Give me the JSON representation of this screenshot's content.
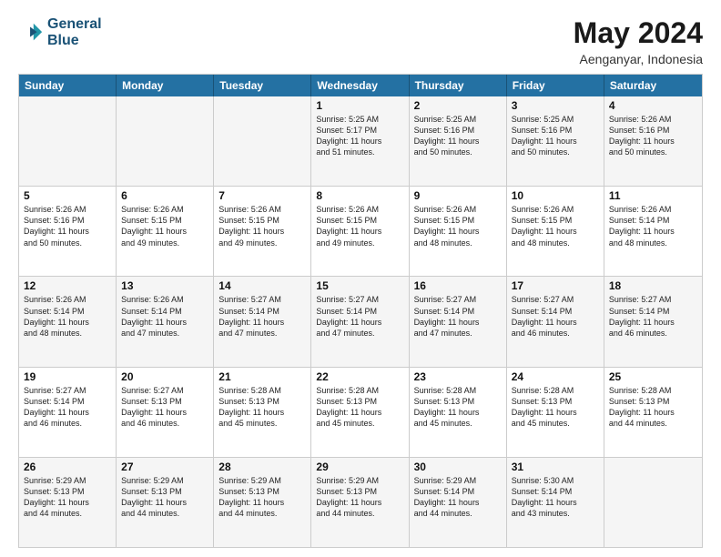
{
  "header": {
    "logo_line1": "General",
    "logo_line2": "Blue",
    "month_year": "May 2024",
    "location": "Aenganyar, Indonesia"
  },
  "weekdays": [
    "Sunday",
    "Monday",
    "Tuesday",
    "Wednesday",
    "Thursday",
    "Friday",
    "Saturday"
  ],
  "rows": [
    [
      {
        "day": "",
        "text": ""
      },
      {
        "day": "",
        "text": ""
      },
      {
        "day": "",
        "text": ""
      },
      {
        "day": "1",
        "text": "Sunrise: 5:25 AM\nSunset: 5:17 PM\nDaylight: 11 hours\nand 51 minutes."
      },
      {
        "day": "2",
        "text": "Sunrise: 5:25 AM\nSunset: 5:16 PM\nDaylight: 11 hours\nand 50 minutes."
      },
      {
        "day": "3",
        "text": "Sunrise: 5:25 AM\nSunset: 5:16 PM\nDaylight: 11 hours\nand 50 minutes."
      },
      {
        "day": "4",
        "text": "Sunrise: 5:26 AM\nSunset: 5:16 PM\nDaylight: 11 hours\nand 50 minutes."
      }
    ],
    [
      {
        "day": "5",
        "text": "Sunrise: 5:26 AM\nSunset: 5:16 PM\nDaylight: 11 hours\nand 50 minutes."
      },
      {
        "day": "6",
        "text": "Sunrise: 5:26 AM\nSunset: 5:15 PM\nDaylight: 11 hours\nand 49 minutes."
      },
      {
        "day": "7",
        "text": "Sunrise: 5:26 AM\nSunset: 5:15 PM\nDaylight: 11 hours\nand 49 minutes."
      },
      {
        "day": "8",
        "text": "Sunrise: 5:26 AM\nSunset: 5:15 PM\nDaylight: 11 hours\nand 49 minutes."
      },
      {
        "day": "9",
        "text": "Sunrise: 5:26 AM\nSunset: 5:15 PM\nDaylight: 11 hours\nand 48 minutes."
      },
      {
        "day": "10",
        "text": "Sunrise: 5:26 AM\nSunset: 5:15 PM\nDaylight: 11 hours\nand 48 minutes."
      },
      {
        "day": "11",
        "text": "Sunrise: 5:26 AM\nSunset: 5:14 PM\nDaylight: 11 hours\nand 48 minutes."
      }
    ],
    [
      {
        "day": "12",
        "text": "Sunrise: 5:26 AM\nSunset: 5:14 PM\nDaylight: 11 hours\nand 48 minutes."
      },
      {
        "day": "13",
        "text": "Sunrise: 5:26 AM\nSunset: 5:14 PM\nDaylight: 11 hours\nand 47 minutes."
      },
      {
        "day": "14",
        "text": "Sunrise: 5:27 AM\nSunset: 5:14 PM\nDaylight: 11 hours\nand 47 minutes."
      },
      {
        "day": "15",
        "text": "Sunrise: 5:27 AM\nSunset: 5:14 PM\nDaylight: 11 hours\nand 47 minutes."
      },
      {
        "day": "16",
        "text": "Sunrise: 5:27 AM\nSunset: 5:14 PM\nDaylight: 11 hours\nand 47 minutes."
      },
      {
        "day": "17",
        "text": "Sunrise: 5:27 AM\nSunset: 5:14 PM\nDaylight: 11 hours\nand 46 minutes."
      },
      {
        "day": "18",
        "text": "Sunrise: 5:27 AM\nSunset: 5:14 PM\nDaylight: 11 hours\nand 46 minutes."
      }
    ],
    [
      {
        "day": "19",
        "text": "Sunrise: 5:27 AM\nSunset: 5:14 PM\nDaylight: 11 hours\nand 46 minutes."
      },
      {
        "day": "20",
        "text": "Sunrise: 5:27 AM\nSunset: 5:13 PM\nDaylight: 11 hours\nand 46 minutes."
      },
      {
        "day": "21",
        "text": "Sunrise: 5:28 AM\nSunset: 5:13 PM\nDaylight: 11 hours\nand 45 minutes."
      },
      {
        "day": "22",
        "text": "Sunrise: 5:28 AM\nSunset: 5:13 PM\nDaylight: 11 hours\nand 45 minutes."
      },
      {
        "day": "23",
        "text": "Sunrise: 5:28 AM\nSunset: 5:13 PM\nDaylight: 11 hours\nand 45 minutes."
      },
      {
        "day": "24",
        "text": "Sunrise: 5:28 AM\nSunset: 5:13 PM\nDaylight: 11 hours\nand 45 minutes."
      },
      {
        "day": "25",
        "text": "Sunrise: 5:28 AM\nSunset: 5:13 PM\nDaylight: 11 hours\nand 44 minutes."
      }
    ],
    [
      {
        "day": "26",
        "text": "Sunrise: 5:29 AM\nSunset: 5:13 PM\nDaylight: 11 hours\nand 44 minutes."
      },
      {
        "day": "27",
        "text": "Sunrise: 5:29 AM\nSunset: 5:13 PM\nDaylight: 11 hours\nand 44 minutes."
      },
      {
        "day": "28",
        "text": "Sunrise: 5:29 AM\nSunset: 5:13 PM\nDaylight: 11 hours\nand 44 minutes."
      },
      {
        "day": "29",
        "text": "Sunrise: 5:29 AM\nSunset: 5:13 PM\nDaylight: 11 hours\nand 44 minutes."
      },
      {
        "day": "30",
        "text": "Sunrise: 5:29 AM\nSunset: 5:14 PM\nDaylight: 11 hours\nand 44 minutes."
      },
      {
        "day": "31",
        "text": "Sunrise: 5:30 AM\nSunset: 5:14 PM\nDaylight: 11 hours\nand 43 minutes."
      },
      {
        "day": "",
        "text": ""
      }
    ]
  ]
}
